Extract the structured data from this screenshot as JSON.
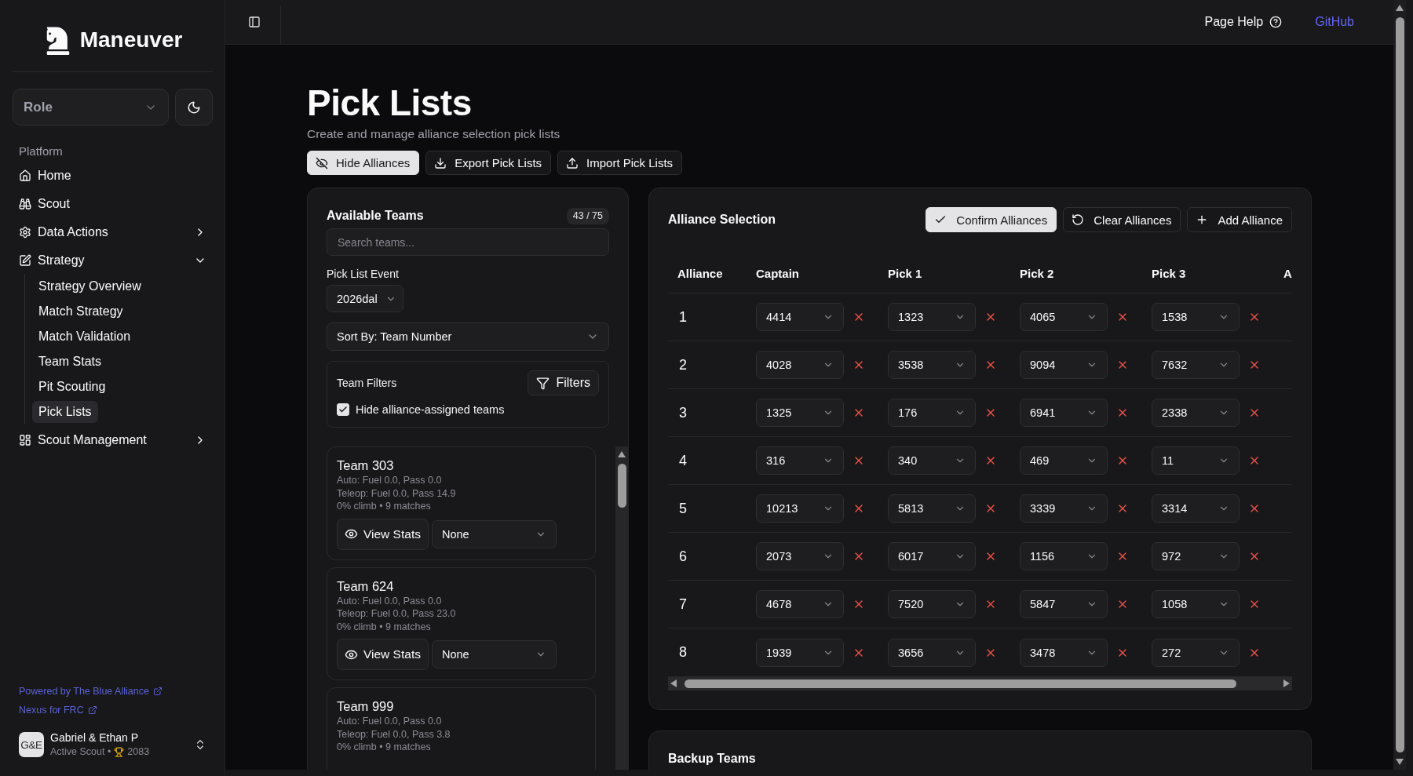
{
  "sidebar": {
    "brand": "Maneuver",
    "role_select": {
      "placeholder": "Role"
    },
    "section_label": "Platform",
    "items": [
      {
        "label": "Home",
        "kind": "link"
      },
      {
        "label": "Scout",
        "kind": "link"
      },
      {
        "label": "Data Actions",
        "kind": "group",
        "expanded": false
      },
      {
        "label": "Strategy",
        "kind": "group",
        "expanded": true,
        "children": [
          {
            "label": "Strategy Overview",
            "selected": false
          },
          {
            "label": "Match Strategy",
            "selected": false
          },
          {
            "label": "Match Validation",
            "selected": false
          },
          {
            "label": "Team Stats",
            "selected": false
          },
          {
            "label": "Pit Scouting",
            "selected": false
          },
          {
            "label": "Pick Lists",
            "selected": true
          }
        ]
      },
      {
        "label": "Scout Management",
        "kind": "group",
        "expanded": false
      }
    ],
    "links": [
      "Powered by The Blue Alliance",
      "Nexus for FRC"
    ],
    "user": {
      "initials": "G&E",
      "name": "Gabriel & Ethan P",
      "status": "Active Scout •",
      "points": "2083"
    }
  },
  "header": {
    "help": "Page Help",
    "link": "GitHub"
  },
  "page": {
    "title": "Pick Lists",
    "subtitle": "Create and manage alliance selection pick lists",
    "actions": [
      {
        "label": "Hide Alliances",
        "kind": "primary"
      },
      {
        "label": "Export Pick Lists",
        "kind": "outline"
      },
      {
        "label": "Import Pick Lists",
        "kind": "outline"
      }
    ]
  },
  "available_teams": {
    "title": "Available Teams",
    "count": "43 / 75",
    "search": {
      "placeholder": "Search teams..."
    },
    "event_label": "Pick List Event",
    "event_select": "2026dal",
    "sort_select": "Sort By: Team Number",
    "filters": {
      "title": "Team Filters",
      "button": "Filters",
      "hide_assigned": {
        "label": "Hide alliance-assigned teams",
        "checked": true
      }
    },
    "teams": [
      {
        "name": "Team 303",
        "lines": [
          "Auto: Fuel 0.0, Pass 0.0",
          "Teleop: Fuel 0.0, Pass 14.9",
          "0% climb • 9 matches"
        ],
        "view_button": "View Stats",
        "assignment": "None"
      },
      {
        "name": "Team 624",
        "lines": [
          "Auto: Fuel 0.0, Pass 0.0",
          "Teleop: Fuel 0.0, Pass 23.0",
          "0% climb • 9 matches"
        ],
        "view_button": "View Stats",
        "assignment": "None"
      },
      {
        "name": "Team 999",
        "lines": [
          "Auto: Fuel 0.0, Pass 0.0",
          "Teleop: Fuel 0.0, Pass 3.8",
          "0% climb • 9 matches"
        ]
      }
    ]
  },
  "alliance_selection": {
    "title": "Alliance Selection",
    "actions": [
      {
        "label": "Confirm Alliances",
        "kind": "primary"
      },
      {
        "label": "Clear Alliances",
        "kind": "outline"
      },
      {
        "label": "Add Alliance",
        "kind": "outline"
      }
    ],
    "table": {
      "columns": [
        "Alliance",
        "Captain",
        "Pick 1",
        "Pick 2",
        "Pick 3",
        "A"
      ],
      "rows": [
        {
          "alliance": "1",
          "teams": [
            "4414",
            "1323",
            "4065",
            "1538"
          ]
        },
        {
          "alliance": "2",
          "teams": [
            "4028",
            "3538",
            "9094",
            "7632"
          ]
        },
        {
          "alliance": "3",
          "teams": [
            "1325",
            "176",
            "6941",
            "2338"
          ]
        },
        {
          "alliance": "4",
          "teams": [
            "316",
            "340",
            "469",
            "11"
          ]
        },
        {
          "alliance": "5",
          "teams": [
            "10213",
            "5813",
            "3339",
            "3314"
          ]
        },
        {
          "alliance": "6",
          "teams": [
            "2073",
            "6017",
            "1156",
            "972"
          ]
        },
        {
          "alliance": "7",
          "teams": [
            "4678",
            "7520",
            "5847",
            "1058"
          ]
        },
        {
          "alliance": "8",
          "teams": [
            "1939",
            "3656",
            "3478",
            "272"
          ]
        }
      ]
    }
  },
  "backup_teams": {
    "title": "Backup Teams"
  }
}
